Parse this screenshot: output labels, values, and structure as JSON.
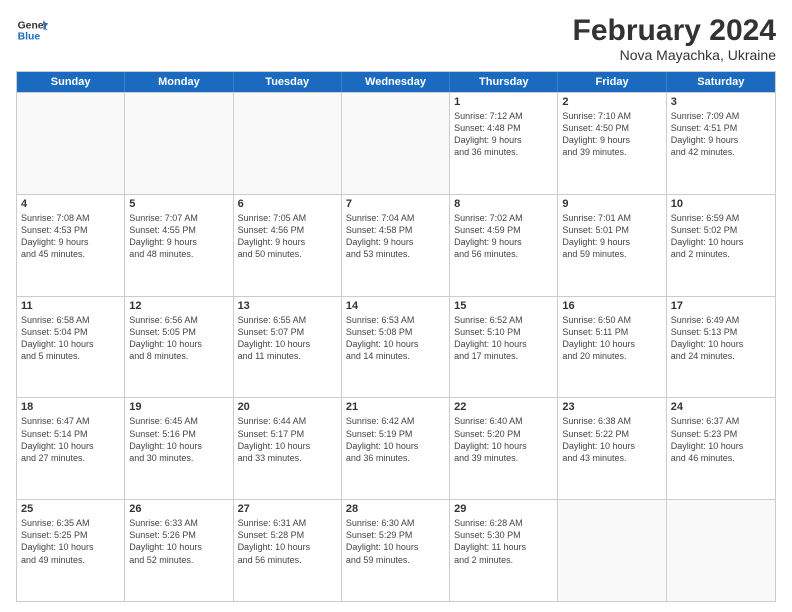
{
  "logo": {
    "line1": "General",
    "line2": "Blue"
  },
  "title": "February 2024",
  "subtitle": "Nova Mayachka, Ukraine",
  "days_header": [
    "Sunday",
    "Monday",
    "Tuesday",
    "Wednesday",
    "Thursday",
    "Friday",
    "Saturday"
  ],
  "rows": [
    [
      {
        "day": "",
        "info": ""
      },
      {
        "day": "",
        "info": ""
      },
      {
        "day": "",
        "info": ""
      },
      {
        "day": "",
        "info": ""
      },
      {
        "day": "1",
        "info": "Sunrise: 7:12 AM\nSunset: 4:48 PM\nDaylight: 9 hours\nand 36 minutes."
      },
      {
        "day": "2",
        "info": "Sunrise: 7:10 AM\nSunset: 4:50 PM\nDaylight: 9 hours\nand 39 minutes."
      },
      {
        "day": "3",
        "info": "Sunrise: 7:09 AM\nSunset: 4:51 PM\nDaylight: 9 hours\nand 42 minutes."
      }
    ],
    [
      {
        "day": "4",
        "info": "Sunrise: 7:08 AM\nSunset: 4:53 PM\nDaylight: 9 hours\nand 45 minutes."
      },
      {
        "day": "5",
        "info": "Sunrise: 7:07 AM\nSunset: 4:55 PM\nDaylight: 9 hours\nand 48 minutes."
      },
      {
        "day": "6",
        "info": "Sunrise: 7:05 AM\nSunset: 4:56 PM\nDaylight: 9 hours\nand 50 minutes."
      },
      {
        "day": "7",
        "info": "Sunrise: 7:04 AM\nSunset: 4:58 PM\nDaylight: 9 hours\nand 53 minutes."
      },
      {
        "day": "8",
        "info": "Sunrise: 7:02 AM\nSunset: 4:59 PM\nDaylight: 9 hours\nand 56 minutes."
      },
      {
        "day": "9",
        "info": "Sunrise: 7:01 AM\nSunset: 5:01 PM\nDaylight: 9 hours\nand 59 minutes."
      },
      {
        "day": "10",
        "info": "Sunrise: 6:59 AM\nSunset: 5:02 PM\nDaylight: 10 hours\nand 2 minutes."
      }
    ],
    [
      {
        "day": "11",
        "info": "Sunrise: 6:58 AM\nSunset: 5:04 PM\nDaylight: 10 hours\nand 5 minutes."
      },
      {
        "day": "12",
        "info": "Sunrise: 6:56 AM\nSunset: 5:05 PM\nDaylight: 10 hours\nand 8 minutes."
      },
      {
        "day": "13",
        "info": "Sunrise: 6:55 AM\nSunset: 5:07 PM\nDaylight: 10 hours\nand 11 minutes."
      },
      {
        "day": "14",
        "info": "Sunrise: 6:53 AM\nSunset: 5:08 PM\nDaylight: 10 hours\nand 14 minutes."
      },
      {
        "day": "15",
        "info": "Sunrise: 6:52 AM\nSunset: 5:10 PM\nDaylight: 10 hours\nand 17 minutes."
      },
      {
        "day": "16",
        "info": "Sunrise: 6:50 AM\nSunset: 5:11 PM\nDaylight: 10 hours\nand 20 minutes."
      },
      {
        "day": "17",
        "info": "Sunrise: 6:49 AM\nSunset: 5:13 PM\nDaylight: 10 hours\nand 24 minutes."
      }
    ],
    [
      {
        "day": "18",
        "info": "Sunrise: 6:47 AM\nSunset: 5:14 PM\nDaylight: 10 hours\nand 27 minutes."
      },
      {
        "day": "19",
        "info": "Sunrise: 6:45 AM\nSunset: 5:16 PM\nDaylight: 10 hours\nand 30 minutes."
      },
      {
        "day": "20",
        "info": "Sunrise: 6:44 AM\nSunset: 5:17 PM\nDaylight: 10 hours\nand 33 minutes."
      },
      {
        "day": "21",
        "info": "Sunrise: 6:42 AM\nSunset: 5:19 PM\nDaylight: 10 hours\nand 36 minutes."
      },
      {
        "day": "22",
        "info": "Sunrise: 6:40 AM\nSunset: 5:20 PM\nDaylight: 10 hours\nand 39 minutes."
      },
      {
        "day": "23",
        "info": "Sunrise: 6:38 AM\nSunset: 5:22 PM\nDaylight: 10 hours\nand 43 minutes."
      },
      {
        "day": "24",
        "info": "Sunrise: 6:37 AM\nSunset: 5:23 PM\nDaylight: 10 hours\nand 46 minutes."
      }
    ],
    [
      {
        "day": "25",
        "info": "Sunrise: 6:35 AM\nSunset: 5:25 PM\nDaylight: 10 hours\nand 49 minutes."
      },
      {
        "day": "26",
        "info": "Sunrise: 6:33 AM\nSunset: 5:26 PM\nDaylight: 10 hours\nand 52 minutes."
      },
      {
        "day": "27",
        "info": "Sunrise: 6:31 AM\nSunset: 5:28 PM\nDaylight: 10 hours\nand 56 minutes."
      },
      {
        "day": "28",
        "info": "Sunrise: 6:30 AM\nSunset: 5:29 PM\nDaylight: 10 hours\nand 59 minutes."
      },
      {
        "day": "29",
        "info": "Sunrise: 6:28 AM\nSunset: 5:30 PM\nDaylight: 11 hours\nand 2 minutes."
      },
      {
        "day": "",
        "info": ""
      },
      {
        "day": "",
        "info": ""
      }
    ]
  ]
}
